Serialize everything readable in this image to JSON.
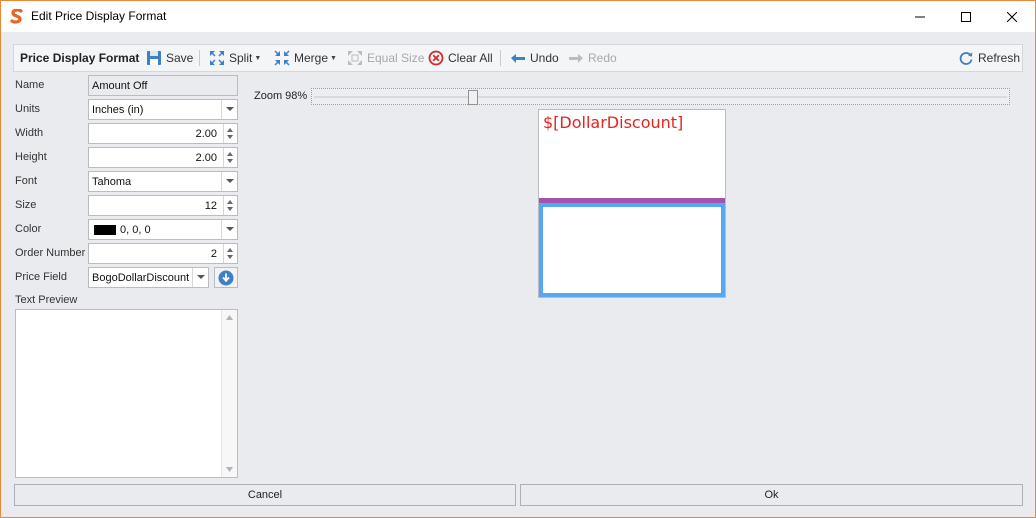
{
  "window": {
    "title": "Edit Price Display Format"
  },
  "toolbar": {
    "title": "Price Display Format",
    "save": "Save",
    "split": "Split",
    "merge": "Merge",
    "equal_size": "Equal Size",
    "clear_all": "Clear All",
    "undo": "Undo",
    "redo": "Redo",
    "refresh": "Refresh"
  },
  "properties": {
    "name": {
      "label": "Name",
      "value": "Amount Off"
    },
    "units": {
      "label": "Units",
      "value": "Inches (in)"
    },
    "width": {
      "label": "Width",
      "value": "2.00"
    },
    "height": {
      "label": "Height",
      "value": "2.00"
    },
    "font": {
      "label": "Font",
      "value": "Tahoma"
    },
    "size": {
      "label": "Size",
      "value": "12"
    },
    "color": {
      "label": "Color",
      "value": "0, 0, 0",
      "swatch": "#000000"
    },
    "order_number": {
      "label": "Order Number",
      "value": "2"
    },
    "price_field": {
      "label": "Price Field",
      "value": "BogoDollarDiscount"
    },
    "text_preview": {
      "label": "Text Preview",
      "value": ""
    }
  },
  "zoom": {
    "label": "Zoom 98%",
    "percent": 98
  },
  "canvas": {
    "text": "$[DollarDiscount]",
    "text_color": "#e8231f",
    "divider_color": "#a252b1",
    "selection_color": "#56a8f1"
  },
  "footer": {
    "cancel": "Cancel",
    "ok": "Ok"
  },
  "colors": {
    "accent_border": "#e8883a",
    "background": "#e9ebef"
  }
}
